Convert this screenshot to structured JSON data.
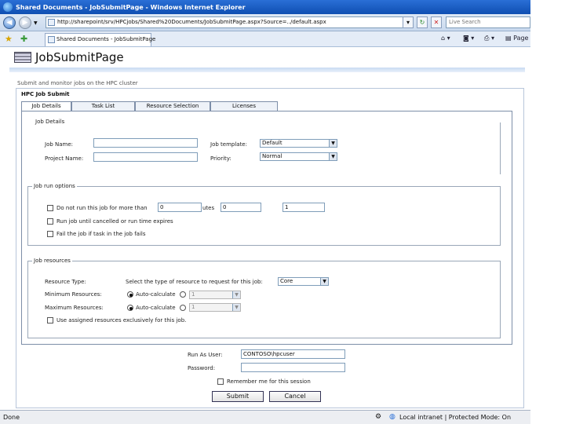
{
  "browser": {
    "window_title": "Shared Documents - JobSubmitPage - Windows Internet Explorer",
    "url": "http://sharepoint/srv/HPCjobs/Shared%20Documents/JobSubmitPage.aspx?Source=../default.aspx",
    "search_placeholder": "Live Search",
    "tab_label": "Shared Documents - JobSubmitPage",
    "command_page_label": "Page",
    "status_left": "Done",
    "status_zone": "Local intranet | Protected Mode: On"
  },
  "page": {
    "title": "JobSubmitPage",
    "description": "Submit and monitor jobs on the HPC cluster",
    "section_title": "HPC Job Submit",
    "tabs": [
      "Job Details",
      "Task List",
      "Resource Selection",
      "Licenses"
    ]
  },
  "job_details": {
    "legend": "Job Details",
    "job_name_label": "Job Name:",
    "job_name_value": "",
    "project_name_label": "Project Name:",
    "project_name_value": "",
    "job_template_label": "Job template:",
    "job_template_value": "Default",
    "priority_label": "Priority:",
    "priority_value": "Normal"
  },
  "run_options": {
    "legend": "Job run options",
    "do_not_run_label": "Do not run this job for more than",
    "days_value": "0",
    "minutes_label": "utes",
    "hours_value": "0",
    "extra_value": "1",
    "run_until_cancelled_label": "Run job until cancelled or run time expires",
    "fail_job_label": "Fail the job if task in the job fails"
  },
  "job_resources": {
    "legend": "Job resources",
    "resource_type_label": "Resource Type:",
    "resource_type_hint": "Select the type of resource to request for this job:",
    "resource_type_value": "Core",
    "min_resources_label": "Minimum Resources:",
    "max_resources_label": "Maximum Resources:",
    "auto_calculate_label": "Auto-calculate",
    "min_value": "1",
    "max_value": "1",
    "exclusive_label": "Use assigned resources exclusively for this job."
  },
  "credentials": {
    "run_as_label": "Run As User:",
    "run_as_value": "CONTOSO\\hpcuser",
    "password_label": "Password:",
    "password_value": "",
    "remember_label": "Remember me for this session",
    "submit_label": "Submit",
    "cancel_label": "Cancel"
  }
}
